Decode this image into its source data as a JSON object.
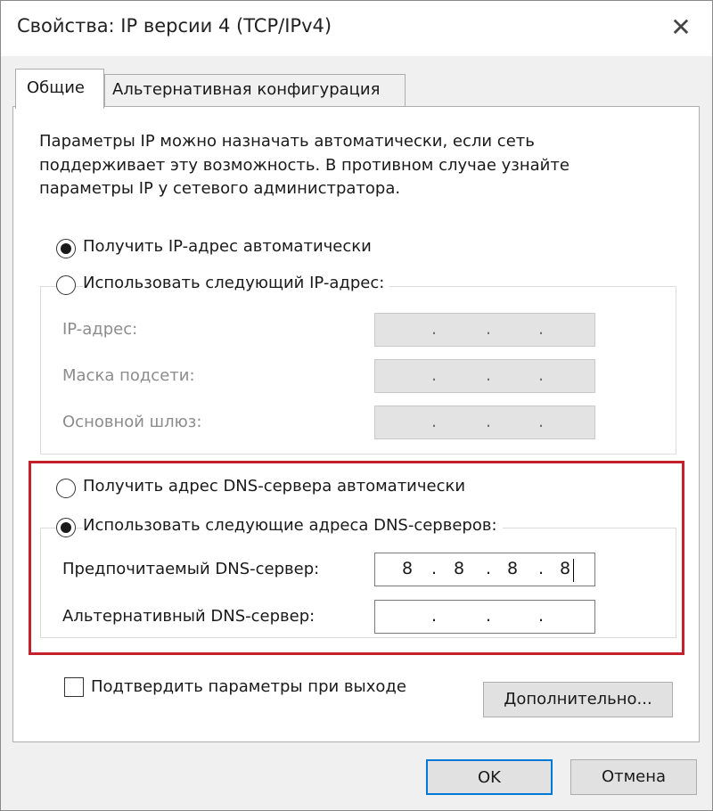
{
  "window": {
    "title": "Свойства: IP версии 4 (TCP/IPv4)",
    "close_glyph": "✕"
  },
  "tabs": [
    {
      "label": "Общие",
      "active": true
    },
    {
      "label": "Альтернативная конфигурация",
      "active": false
    }
  ],
  "description": "Параметры IP можно назначать автоматически, если сеть поддерживает эту возможность. В противном случае узнайте параметры IP у сетевого администратора.",
  "ip_mode": {
    "auto_label": "Получить IP-адрес автоматически",
    "auto_selected": true,
    "manual_label": "Использовать следующий IP-адрес:",
    "manual_selected": false
  },
  "ip_fields": [
    {
      "label": "IP-адрес:",
      "value": [
        "",
        "",
        "",
        ""
      ]
    },
    {
      "label": "Маска подсети:",
      "value": [
        "",
        "",
        "",
        ""
      ]
    },
    {
      "label": "Основной шлюз:",
      "value": [
        "",
        "",
        "",
        ""
      ]
    }
  ],
  "dns_mode": {
    "auto_label": "Получить адрес DNS-сервера автоматически",
    "auto_selected": false,
    "manual_label": "Использовать следующие адреса DNS-серверов:",
    "manual_selected": true
  },
  "dns_fields": [
    {
      "label": "Предпочитаемый DNS-сервер:",
      "value": [
        "8",
        "8",
        "8",
        "8"
      ]
    },
    {
      "label": "Альтернативный DNS-сервер:",
      "value": [
        "",
        "",
        "",
        ""
      ]
    }
  ],
  "ip_separator": ".",
  "validate_checkbox": {
    "label": "Подтвердить параметры при выходе",
    "checked": false
  },
  "buttons": {
    "advanced": "Дополнительно...",
    "ok": "OK",
    "cancel": "Отмена"
  },
  "colors": {
    "highlight_border": "#c4212f",
    "default_button_border": "#0078d7"
  }
}
